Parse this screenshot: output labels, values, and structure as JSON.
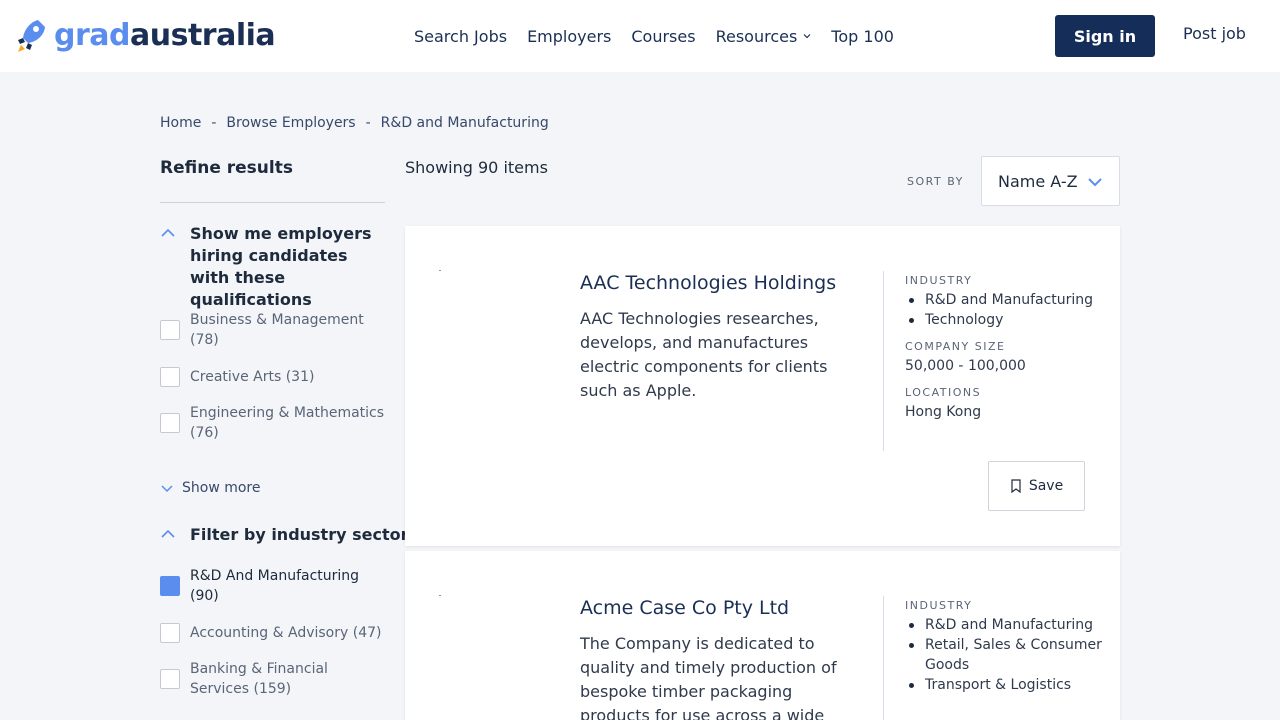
{
  "header": {
    "logo_part1": "grad",
    "logo_part2": "australia",
    "nav": [
      "Search Jobs",
      "Employers",
      "Courses",
      "Resources",
      "Top 100"
    ],
    "signin": "Sign in",
    "postjob": "Post job",
    "colors": {
      "brand_dark": "#152d59",
      "brand_accent": "#5b8def"
    }
  },
  "breadcrumb": [
    "Home",
    "Browse Employers",
    "R&D and Manufacturing"
  ],
  "breadcrumb_sep": "-",
  "sidebar": {
    "title": "Refine results",
    "qual_heading": "Show me employers hiring candidates with these qualifications",
    "qual_items": [
      {
        "label": "Business & Management (78)",
        "checked": false
      },
      {
        "label": "Creative Arts (31)",
        "checked": false
      },
      {
        "label": "Engineering & Mathematics (76)",
        "checked": false
      }
    ],
    "show_more": "Show more",
    "industry_heading": "Filter by industry sector",
    "industry_items": [
      {
        "label": "R&D And Manufacturing (90)",
        "checked": true
      },
      {
        "label": "Accounting & Advisory (47)",
        "checked": false
      },
      {
        "label": "Banking & Financial Services (159)",
        "checked": false
      }
    ]
  },
  "results": {
    "showing": "Showing 90 items",
    "sort_label": "SORT BY",
    "sort_value": "Name A-Z"
  },
  "cards": [
    {
      "name": "AAC Technologies Holdings",
      "desc": "AAC Technologies researches, develops, and manufactures electric components for clients such as Apple.",
      "industry_label": "INDUSTRY",
      "industries": [
        "R&D and Manufacturing",
        "Technology"
      ],
      "size_label": "COMPANY SIZE",
      "size": "50,000 - 100,000",
      "loc_label": "LOCATIONS",
      "location": "Hong Kong",
      "save": "Save"
    },
    {
      "name": "Acme Case Co Pty Ltd",
      "desc": "The Company is dedicated to quality and timely production of bespoke timber packaging products for use across a wide",
      "industry_label": "INDUSTRY",
      "industries": [
        "R&D and Manufacturing",
        "Retail, Sales & Consumer Goods",
        "Transport & Logistics"
      ]
    }
  ]
}
